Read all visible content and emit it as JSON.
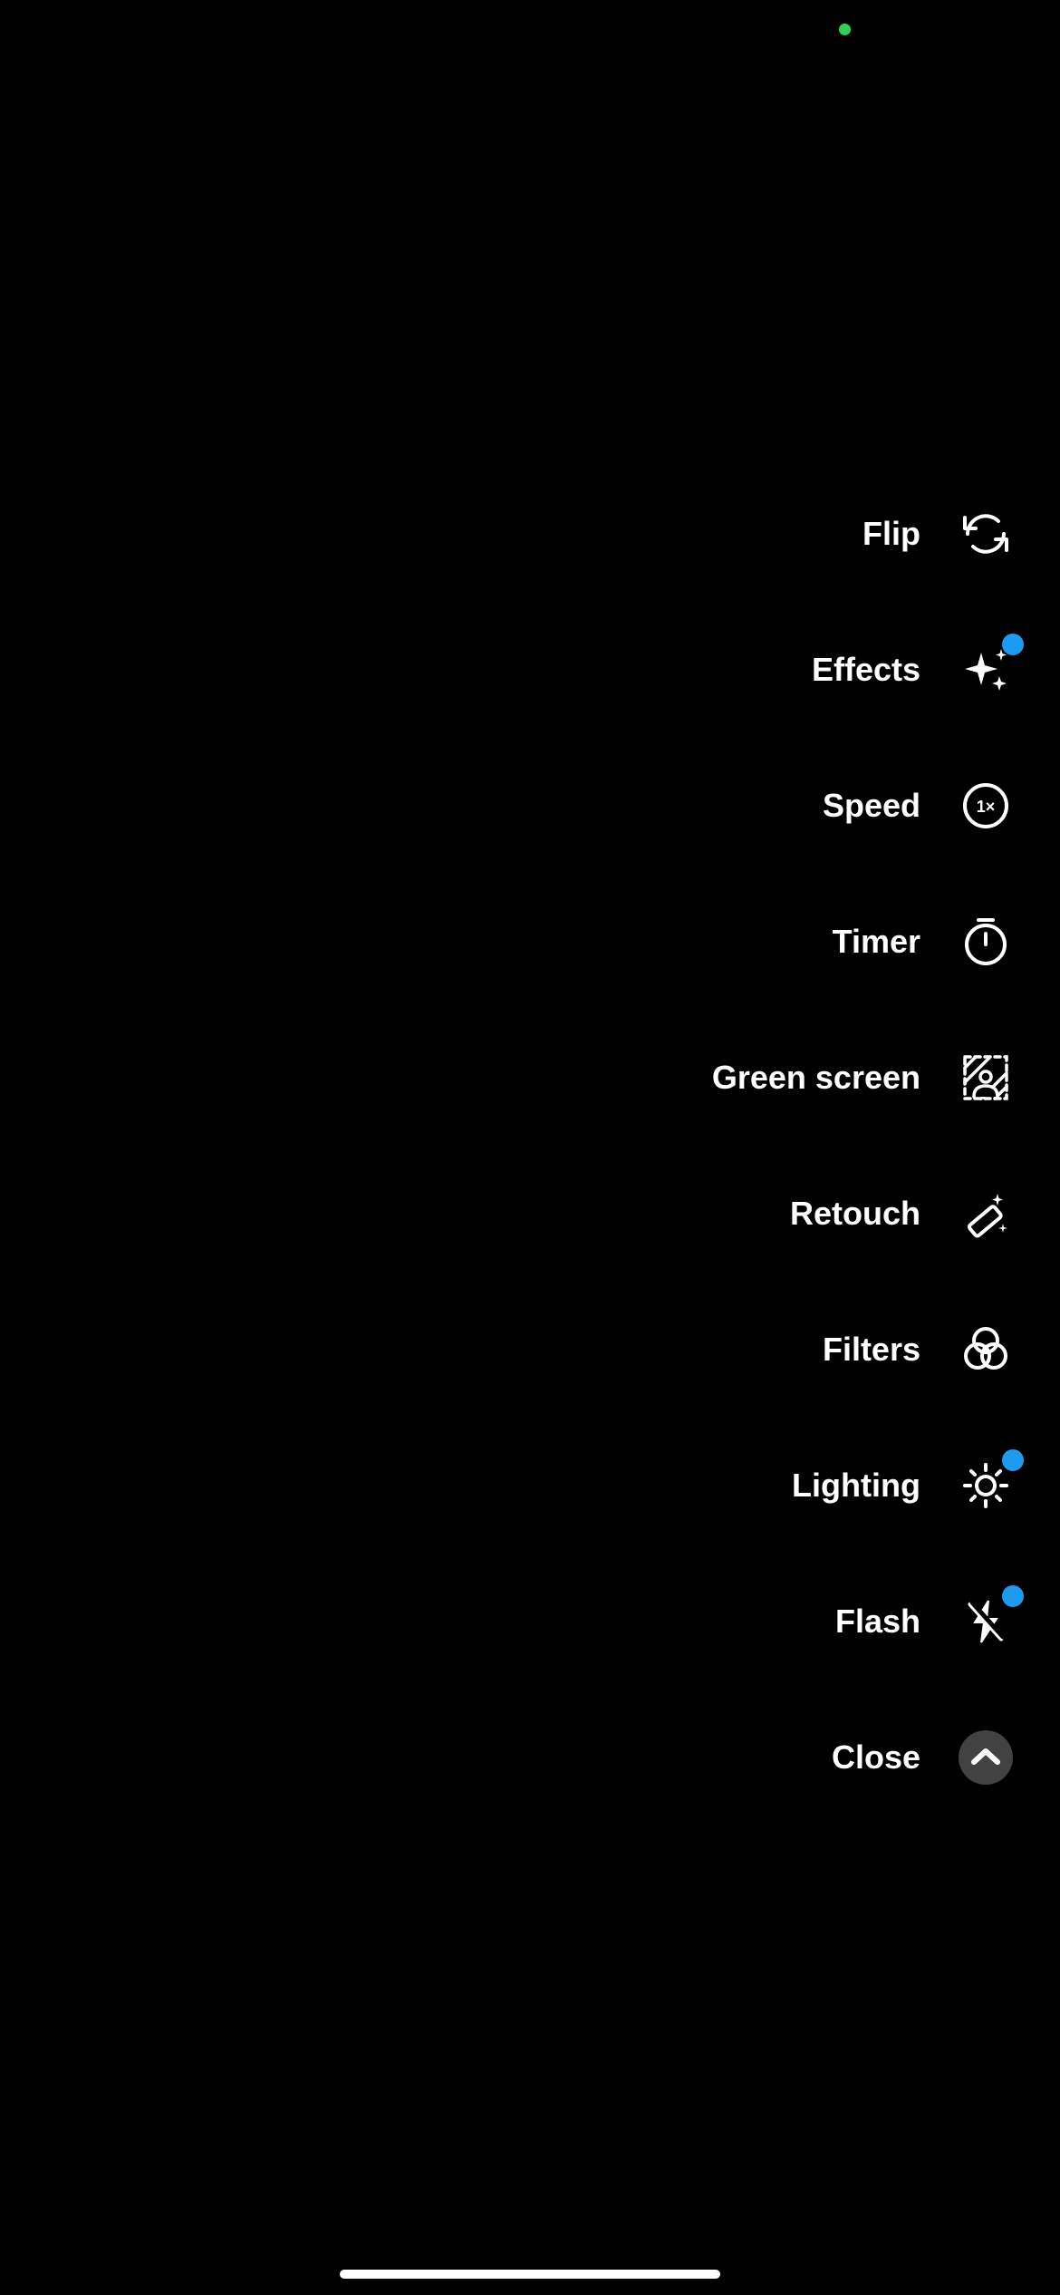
{
  "sidebar": {
    "items": [
      {
        "id": "flip",
        "label": "Flip",
        "badge": false
      },
      {
        "id": "effects",
        "label": "Effects",
        "badge": true
      },
      {
        "id": "speed",
        "label": "Speed",
        "badge": false,
        "speedValue": "1×"
      },
      {
        "id": "timer",
        "label": "Timer",
        "badge": false
      },
      {
        "id": "greenscreen",
        "label": "Green screen",
        "badge": false
      },
      {
        "id": "retouch",
        "label": "Retouch",
        "badge": false
      },
      {
        "id": "filters",
        "label": "Filters",
        "badge": false
      },
      {
        "id": "lighting",
        "label": "Lighting",
        "badge": true
      },
      {
        "id": "flash",
        "label": "Flash",
        "badge": true
      },
      {
        "id": "close",
        "label": "Close",
        "badge": false
      }
    ]
  },
  "colors": {
    "badge": "#1d9bf0",
    "cameraDot": "#30d158"
  }
}
